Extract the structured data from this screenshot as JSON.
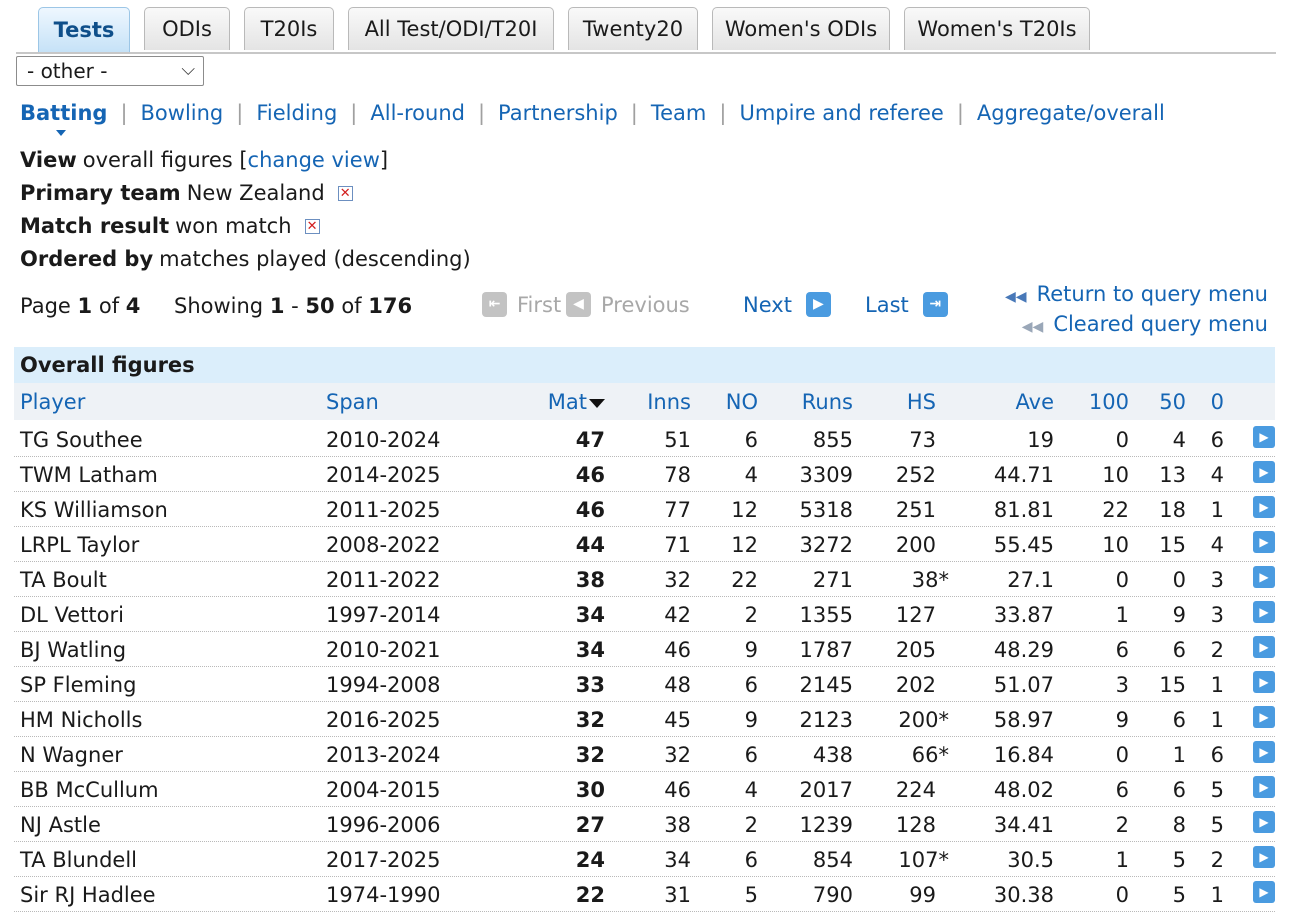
{
  "tabs": [
    "Tests",
    "ODIs",
    "T20Is",
    "All Test/ODI/T20I",
    "Twenty20",
    "Women's ODIs",
    "Women's T20Is"
  ],
  "other_select": {
    "value": "- other -"
  },
  "stat_nav": [
    "Batting",
    "Bowling",
    "Fielding",
    "All-round",
    "Partnership",
    "Team",
    "Umpire and referee",
    "Aggregate/overall"
  ],
  "filters": {
    "view_label": "View",
    "view_value": "overall figures [",
    "change_view": "change view",
    "view_close": "]",
    "primary_label": "Primary team",
    "primary_value": "New Zealand",
    "result_label": "Match result",
    "result_value": "won match",
    "ordered_label": "Ordered by",
    "ordered_value": "matches played (descending)",
    "remove_icon": "✕"
  },
  "pagination": {
    "page_word": "Page",
    "page": "1",
    "of_word": "of",
    "pages": "4",
    "showing_word": "Showing",
    "from": "1",
    "dash": "-",
    "to": "50",
    "of_word2": "of",
    "total": "176",
    "first": "First",
    "previous": "Previous",
    "next": "Next",
    "last": "Last",
    "return_query": "Return to query menu",
    "cleared_query": "Cleared query menu"
  },
  "table": {
    "caption": "Overall figures",
    "headers": [
      "Player",
      "Span",
      "Mat",
      "Inns",
      "NO",
      "Runs",
      "HS",
      "Ave",
      "100",
      "50",
      "0"
    ],
    "rows": [
      [
        "TG Southee",
        "2010-2024",
        "47",
        "51",
        "6",
        "855",
        "73",
        "19",
        "0",
        "4",
        "6"
      ],
      [
        "TWM Latham",
        "2014-2025",
        "46",
        "78",
        "4",
        "3309",
        "252",
        "44.71",
        "10",
        "13",
        "4"
      ],
      [
        "KS Williamson",
        "2011-2025",
        "46",
        "77",
        "12",
        "5318",
        "251",
        "81.81",
        "22",
        "18",
        "1"
      ],
      [
        "LRPL Taylor",
        "2008-2022",
        "44",
        "71",
        "12",
        "3272",
        "200",
        "55.45",
        "10",
        "15",
        "4"
      ],
      [
        "TA Boult",
        "2011-2022",
        "38",
        "32",
        "22",
        "271",
        "38*",
        "27.1",
        "0",
        "0",
        "3"
      ],
      [
        "DL Vettori",
        "1997-2014",
        "34",
        "42",
        "2",
        "1355",
        "127",
        "33.87",
        "1",
        "9",
        "3"
      ],
      [
        "BJ Watling",
        "2010-2021",
        "34",
        "46",
        "9",
        "1787",
        "205",
        "48.29",
        "6",
        "6",
        "2"
      ],
      [
        "SP Fleming",
        "1994-2008",
        "33",
        "48",
        "6",
        "2145",
        "202",
        "51.07",
        "3",
        "15",
        "1"
      ],
      [
        "HM Nicholls",
        "2016-2025",
        "32",
        "45",
        "9",
        "2123",
        "200*",
        "58.97",
        "9",
        "6",
        "1"
      ],
      [
        "N Wagner",
        "2013-2024",
        "32",
        "32",
        "6",
        "438",
        "66*",
        "16.84",
        "0",
        "1",
        "6"
      ],
      [
        "BB McCullum",
        "2004-2015",
        "30",
        "46",
        "4",
        "2017",
        "224",
        "48.02",
        "6",
        "6",
        "5"
      ],
      [
        "NJ Astle",
        "1996-2006",
        "27",
        "38",
        "2",
        "1239",
        "128",
        "34.41",
        "2",
        "8",
        "5"
      ],
      [
        "TA Blundell",
        "2017-2025",
        "24",
        "34",
        "6",
        "854",
        "107*",
        "30.5",
        "1",
        "5",
        "2"
      ],
      [
        "Sir RJ Hadlee",
        "1974-1990",
        "22",
        "31",
        "5",
        "790",
        "99",
        "30.38",
        "0",
        "5",
        "1"
      ]
    ]
  },
  "colors": {
    "link": "#1565b4",
    "caption_bg": "#dbeefb",
    "header_bg": "#eef2f6",
    "button": "#4a9be0"
  }
}
